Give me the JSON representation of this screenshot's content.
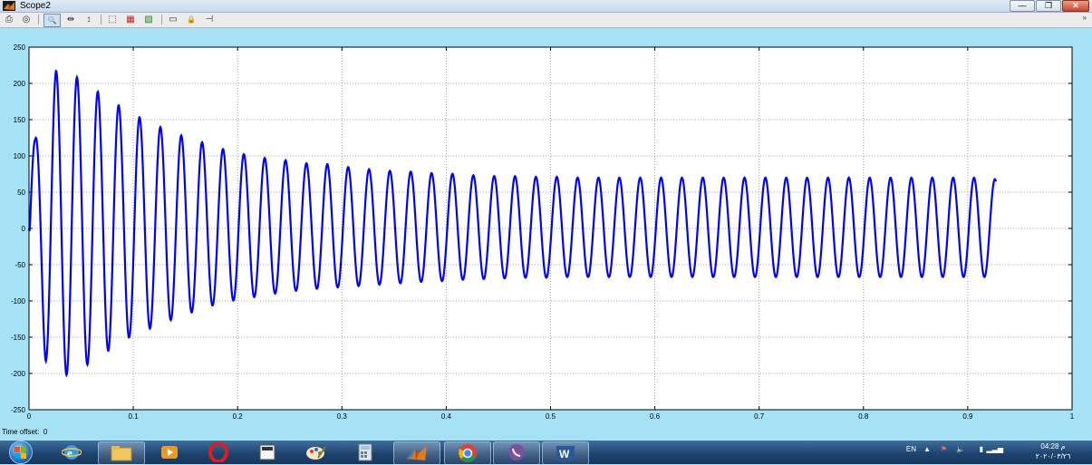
{
  "window": {
    "title": "Scope2",
    "minimize_symbol": "—",
    "maximize_symbol": "❐",
    "close_symbol": "✕"
  },
  "toolbar": {
    "buttons": [
      {
        "name": "print-button",
        "icon": "print-icon",
        "glyph": "⎙"
      },
      {
        "name": "parameters-button",
        "icon": "parameters-icon",
        "glyph": "◎"
      },
      {
        "name": "zoom-in-button",
        "icon": "zoom-in-icon",
        "glyph": "🔍",
        "active": true
      },
      {
        "name": "zoom-x-button",
        "icon": "zoom-x-icon",
        "glyph": "⇹"
      },
      {
        "name": "zoom-y-button",
        "icon": "zoom-y-icon",
        "glyph": "↕"
      },
      {
        "name": "autoscale-button",
        "icon": "autoscale-icon",
        "glyph": "⬚"
      },
      {
        "name": "save-axes-button",
        "icon": "save-axes-icon",
        "glyph": "▦"
      },
      {
        "name": "restore-axes-button",
        "icon": "restore-axes-icon",
        "glyph": "▧"
      },
      {
        "name": "floating-scope-button",
        "icon": "floating-scope-icon",
        "glyph": "▭"
      },
      {
        "name": "lock-axes-button",
        "icon": "lock-icon",
        "glyph": "🔒"
      },
      {
        "name": "signal-selection-button",
        "icon": "signal-selection-icon",
        "glyph": "⊣"
      }
    ],
    "overflow_glyph": "»"
  },
  "time_offset": {
    "label": "Time offset:",
    "value": "0"
  },
  "taskbar": {
    "apps": [
      "windows-explorer",
      "internet-explorer",
      "file-explorer",
      "media-player",
      "opera",
      "calculator-app",
      "paint",
      "calculator",
      "matlab",
      "chrome",
      "viber",
      "word"
    ],
    "language": "EN",
    "clock_time": "04:28 م",
    "clock_date": "٢٠٢٠/٠٣/٢٦"
  },
  "colors": {
    "signal": "#0000ff",
    "plot_bg": "#ffffff",
    "window_bg": "#a6e2f5",
    "grid": "#8a8a8a"
  },
  "chart_data": {
    "type": "line",
    "title": "",
    "xlabel": "",
    "ylabel": "",
    "xlim": [
      0,
      1
    ],
    "ylim": [
      -250,
      250
    ],
    "x_ticks": [
      "0",
      "0.1",
      "0.2",
      "0.3",
      "0.4",
      "0.5",
      "0.6",
      "0.7",
      "0.8",
      "0.9",
      "1"
    ],
    "y_ticks": [
      "250",
      "200",
      "150",
      "100",
      "50",
      "0",
      "-50",
      "-100",
      "-150",
      "-200",
      "-250"
    ],
    "grid": true,
    "series": [
      {
        "color": "#0000ff",
        "frequency_hz": 50,
        "t_end": 0.927,
        "peaks": [
          [
            0.006,
            115
          ],
          [
            0.016,
            -190
          ],
          [
            0.026,
            211
          ],
          [
            0.036,
            -208
          ],
          [
            0.046,
            203
          ],
          [
            0.056,
            -193
          ],
          [
            0.066,
            184
          ],
          [
            0.076,
            -173
          ],
          [
            0.086,
            166
          ],
          [
            0.096,
            -154
          ],
          [
            0.106,
            150
          ],
          [
            0.116,
            -141
          ],
          [
            0.126,
            137
          ],
          [
            0.136,
            -129
          ],
          [
            0.146,
            126
          ],
          [
            0.156,
            -118
          ],
          [
            0.166,
            117
          ],
          [
            0.176,
            -108
          ],
          [
            0.186,
            108
          ],
          [
            0.196,
            -101
          ],
          [
            0.206,
            101
          ],
          [
            0.216,
            -96
          ],
          [
            0.226,
            96
          ],
          [
            0.236,
            -91
          ],
          [
            0.246,
            93
          ],
          [
            0.256,
            -87
          ],
          [
            0.266,
            89
          ],
          [
            0.276,
            -84
          ],
          [
            0.286,
            88
          ],
          [
            0.296,
            -82
          ],
          [
            0.306,
            84
          ],
          [
            0.316,
            -80
          ],
          [
            0.326,
            81
          ],
          [
            0.336,
            -78
          ],
          [
            0.346,
            79
          ],
          [
            0.356,
            -76
          ],
          [
            0.366,
            78
          ],
          [
            0.376,
            -74
          ],
          [
            0.386,
            76
          ],
          [
            0.396,
            -73
          ],
          [
            0.406,
            75
          ],
          [
            0.416,
            -71
          ],
          [
            0.426,
            73
          ],
          [
            0.436,
            -70
          ],
          [
            0.446,
            72
          ],
          [
            0.456,
            -69
          ],
          [
            0.466,
            72
          ],
          [
            0.476,
            -68
          ],
          [
            0.486,
            71
          ],
          [
            0.496,
            -68
          ],
          [
            0.506,
            71
          ],
          [
            0.516,
            -67
          ],
          [
            0.526,
            70
          ],
          [
            0.536,
            -67
          ],
          [
            0.546,
            70
          ],
          [
            0.556,
            -67
          ],
          [
            0.566,
            70
          ],
          [
            0.576,
            -67
          ],
          [
            0.586,
            70
          ],
          [
            0.596,
            -67
          ],
          [
            0.606,
            70
          ],
          [
            0.616,
            -67
          ],
          [
            0.626,
            70
          ],
          [
            0.636,
            -67
          ],
          [
            0.646,
            70
          ],
          [
            0.656,
            -67
          ],
          [
            0.666,
            70
          ],
          [
            0.676,
            -67
          ],
          [
            0.686,
            70
          ],
          [
            0.696,
            -67
          ],
          [
            0.706,
            70
          ],
          [
            0.716,
            -67
          ],
          [
            0.726,
            70
          ],
          [
            0.736,
            -67
          ],
          [
            0.746,
            70
          ],
          [
            0.756,
            -67
          ],
          [
            0.766,
            70
          ],
          [
            0.776,
            -67
          ],
          [
            0.786,
            70
          ],
          [
            0.796,
            -67
          ],
          [
            0.806,
            70
          ],
          [
            0.816,
            -67
          ],
          [
            0.826,
            70
          ],
          [
            0.836,
            -67
          ],
          [
            0.846,
            70
          ],
          [
            0.856,
            -67
          ],
          [
            0.866,
            70
          ],
          [
            0.876,
            -67
          ],
          [
            0.886,
            70
          ],
          [
            0.896,
            -67
          ],
          [
            0.906,
            70
          ],
          [
            0.916,
            -67
          ],
          [
            0.926,
            68
          ]
        ]
      }
    ]
  }
}
